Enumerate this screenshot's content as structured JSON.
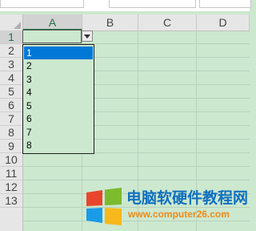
{
  "columns": [
    "A",
    "B",
    "C",
    "D"
  ],
  "rows": [
    "1",
    "2",
    "3",
    "4",
    "5",
    "6",
    "7",
    "8",
    "9",
    "10",
    "11",
    "12",
    "13"
  ],
  "active_cell": {
    "column": "A",
    "row": "1",
    "value": ""
  },
  "dropdown": {
    "options": [
      "1",
      "2",
      "3",
      "4",
      "5",
      "6",
      "7",
      "8"
    ],
    "highlighted_index": 0
  },
  "watermark": {
    "title": "电脑软硬件教程网",
    "url": "www.computer26.com"
  },
  "colors": {
    "sheet_background": "#cce8cf",
    "highlight": "#0078d7",
    "excel_green": "#217346",
    "logo_red": "#e8452c",
    "logo_green": "#7cbb2e",
    "logo_blue": "#1a9be8",
    "logo_yellow": "#f6b81d"
  }
}
